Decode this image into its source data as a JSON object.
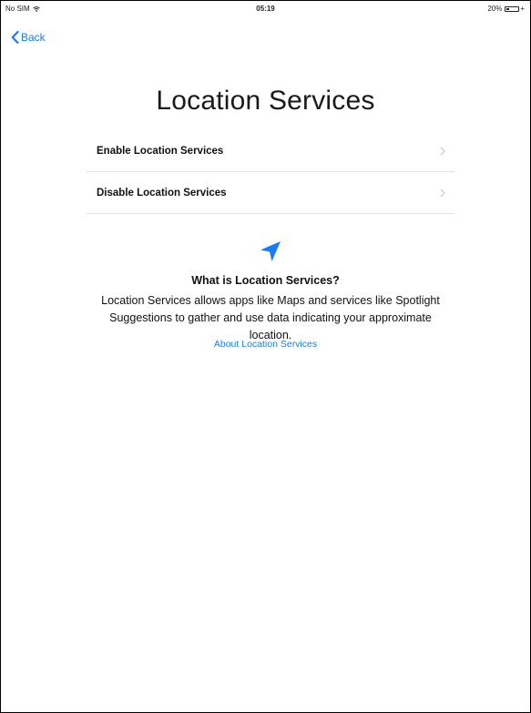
{
  "status_bar": {
    "carrier": "No SIM",
    "time": "05:19",
    "battery": "20%"
  },
  "navigation": {
    "back_label": "Back"
  },
  "page": {
    "title": "Location Services"
  },
  "options": [
    {
      "label": "Enable Location Services"
    },
    {
      "label": "Disable Location Services"
    }
  ],
  "info": {
    "icon": "location-arrow-icon",
    "title": "What is Location Services?",
    "body": "Location Services allows apps like Maps and services like Spotlight Suggestions to gather and use data indicating your approximate location.",
    "link": "About Location Services"
  },
  "colors": {
    "accent": "#1a7cf4",
    "divider": "#e3e3e3",
    "text": "#111111"
  }
}
